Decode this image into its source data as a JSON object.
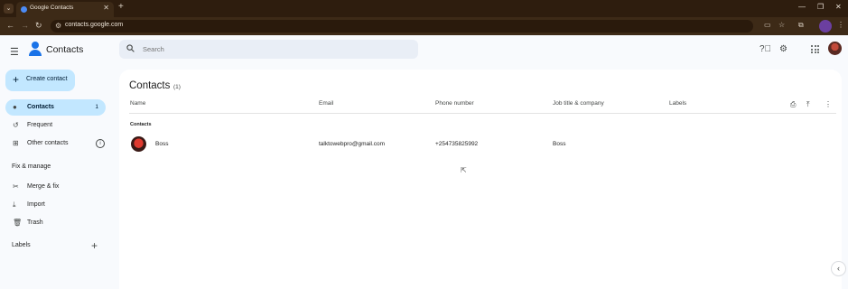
{
  "browser": {
    "tab_title": "Google Contacts",
    "url": "contacts.google.com"
  },
  "app": {
    "title": "Contacts",
    "search_placeholder": "Search"
  },
  "sidebar": {
    "create_label": "Create contact",
    "items": [
      {
        "label": "Contacts",
        "count": "1",
        "icon": "person-icon",
        "active": true
      },
      {
        "label": "Frequent",
        "icon": "history-icon"
      },
      {
        "label": "Other contacts",
        "icon": "inbox-icon"
      }
    ],
    "fix_manage_header": "Fix & manage",
    "fix_items": [
      {
        "label": "Merge & fix",
        "icon": "tools-icon"
      },
      {
        "label": "Import",
        "icon": "download-icon"
      },
      {
        "label": "Trash",
        "icon": "trash-icon"
      }
    ],
    "labels_header": "Labels"
  },
  "main": {
    "title": "Contacts",
    "count": "(1)",
    "columns": [
      "Name",
      "Email",
      "Phone number",
      "Job title & company",
      "Labels"
    ],
    "group_label": "Contacts",
    "rows": [
      {
        "name": "Boss",
        "email": "talktowebpro@gmail.com",
        "phone": "+254735825992",
        "job": "Boss",
        "labels": ""
      }
    ]
  }
}
